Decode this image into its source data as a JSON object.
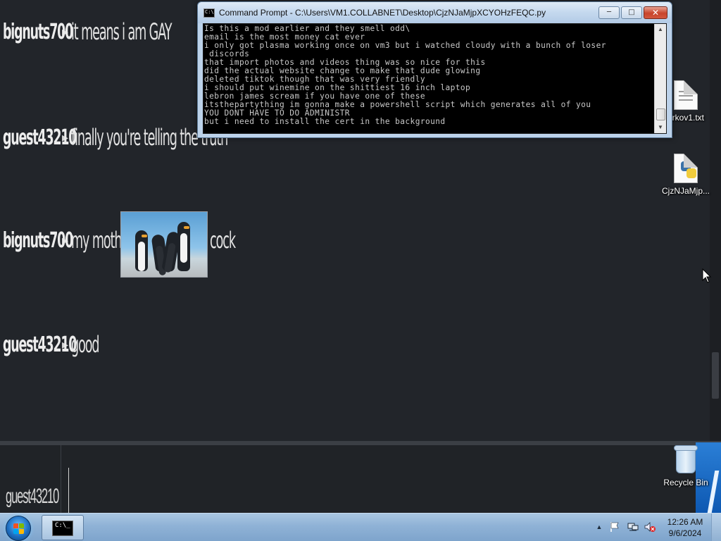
{
  "chat": {
    "messages": [
      {
        "user": "bignuts700",
        "text": "it means i am GAY"
      },
      {
        "user": "guest43210",
        "text": "finally you're telling the truth"
      },
      {
        "user": "bignuts700",
        "text_before": "my mother is",
        "text_after": "cock",
        "has_image": true
      },
      {
        "user": "guest43210",
        "text": "good"
      }
    ],
    "input_user": "guest43210",
    "prompt_arrow": "▸"
  },
  "cmd_window": {
    "title": "Command Prompt - C:\\Users\\VM1.COLLABNET\\Desktop\\CjzNJaMjpXCYOHzFEQC.py",
    "icon_text": "C:\\",
    "minimize_label": "─",
    "maximize_label": "□",
    "close_label": "✕",
    "lines": [
      "Is this a mod earlier and they smell odd\\",
      "email is the most money cat ever",
      "i only got plasma working once on vm3 but i watched cloudy with a bunch of loser",
      " discords",
      "that import photos and videos thing was so nice for this",
      "did the actual website change to make that dude glowing",
      "deleted tiktok though that was very friendly",
      "i should put winemine on the shittiest 16 inch laptop",
      "lebron james scream if you have one of these",
      "itsthepartything im gonna make a powershell script which generates all of you",
      "YOU DONT HAVE TO DO ADMINISTR",
      "but i need to install the cert in the background"
    ]
  },
  "desktop_icons": [
    {
      "label": "arkov1.txt",
      "icon": "text-file-icon"
    },
    {
      "label": "CjzNJaMjp...",
      "icon": "python-file-icon"
    },
    {
      "label": "Recycle Bin",
      "icon": "recycle-bin-icon"
    }
  ],
  "taskbar": {
    "task_icon_text": "C:\\_",
    "time": "12:26 AM",
    "date": "9/6/2024",
    "tray_chevron": "▲"
  },
  "colors": {
    "background": "#22252a",
    "taskbar": "#8fb2d6",
    "close_button": "#c8442b"
  }
}
